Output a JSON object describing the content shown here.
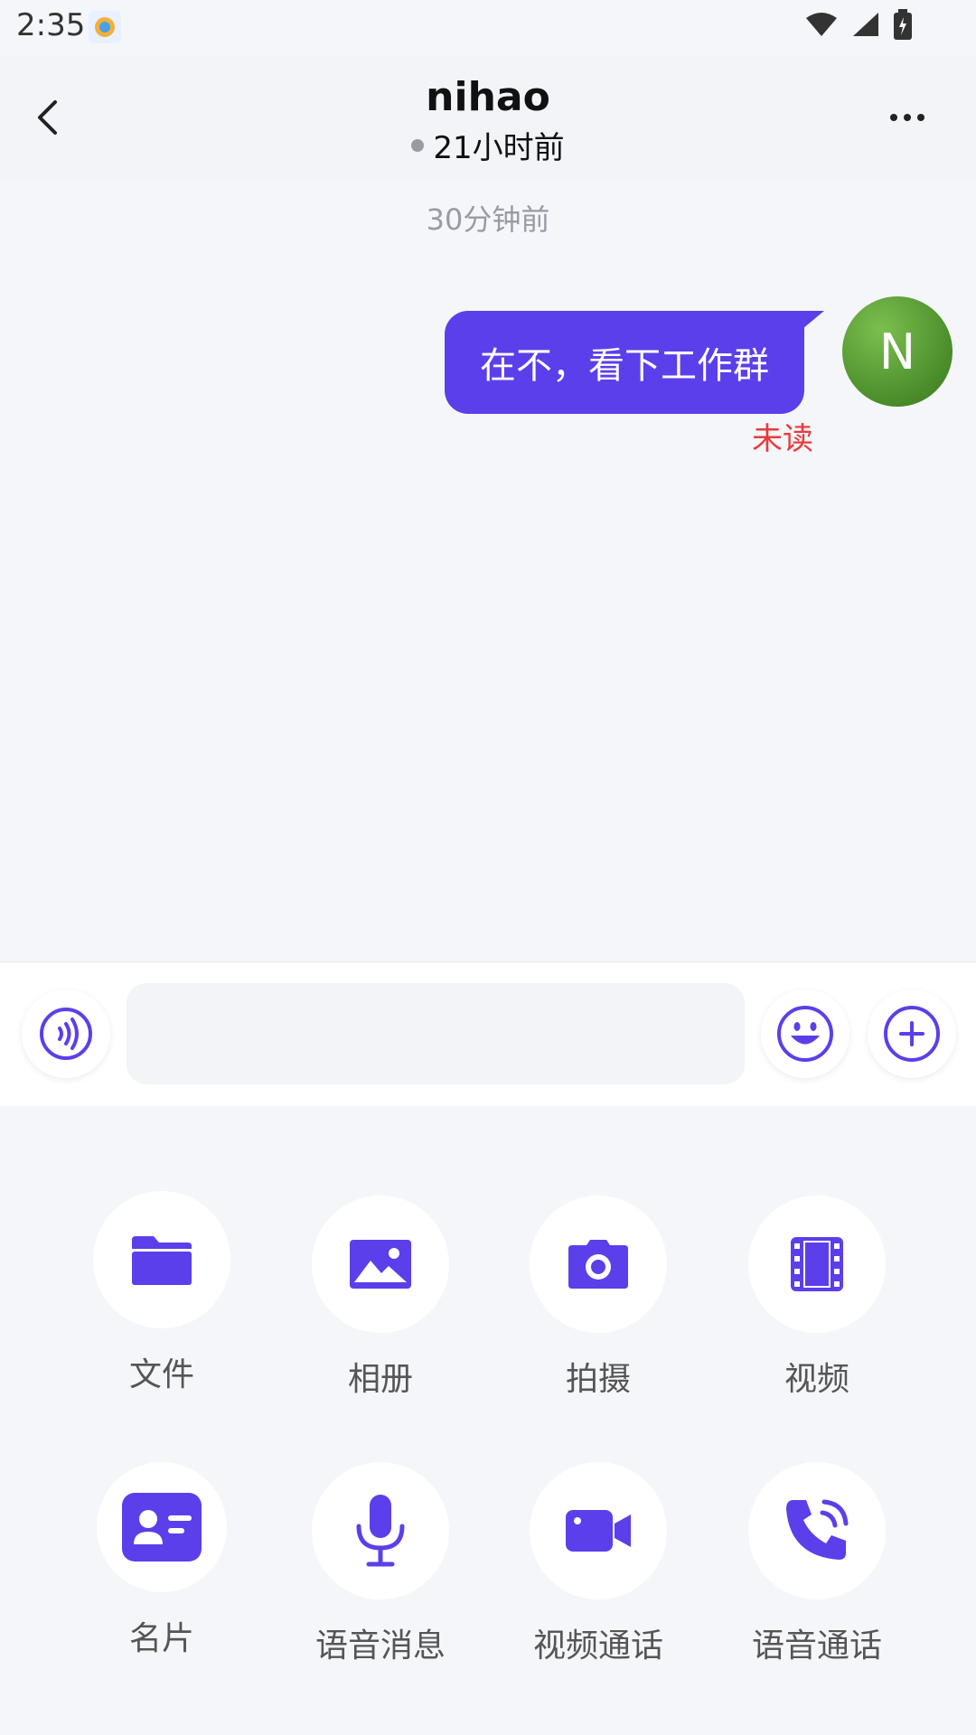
{
  "status_bar": {
    "time": "2:35"
  },
  "header": {
    "title": "nihao",
    "last_seen": "21小时前"
  },
  "messages": [
    {
      "timestamp": "30分钟前",
      "text": "在不，看下工作群",
      "avatar_initial": "N",
      "read_status": "未读"
    }
  ],
  "input": {
    "placeholder": ""
  },
  "panel": {
    "items": [
      {
        "label": "文件",
        "icon": "folder-icon"
      },
      {
        "label": "相册",
        "icon": "image-icon"
      },
      {
        "label": "拍摄",
        "icon": "camera-icon"
      },
      {
        "label": "视频",
        "icon": "film-icon"
      },
      {
        "label": "名片",
        "icon": "contact-card-icon"
      },
      {
        "label": "语音消息",
        "icon": "microphone-icon"
      },
      {
        "label": "视频通话",
        "icon": "video-call-icon"
      },
      {
        "label": "语音通话",
        "icon": "phone-call-icon"
      }
    ]
  },
  "colors": {
    "accent": "#5b3fea",
    "unread": "#e83b3b",
    "avatar": "#5a9e36"
  }
}
